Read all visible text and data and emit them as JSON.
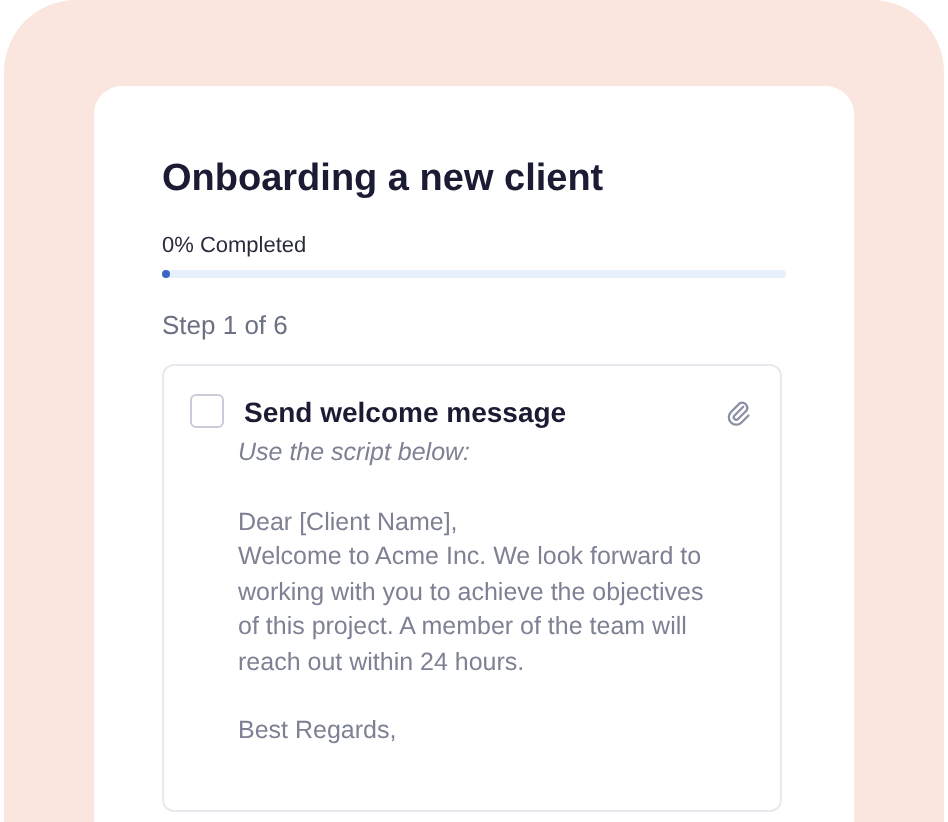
{
  "title": "Onboarding a new client",
  "progress": {
    "label": "0% Completed",
    "level": 0
  },
  "step": "Step 1 of 6",
  "task": {
    "title": "Send welcome message",
    "checked": false,
    "instruction": "Use the script below:",
    "blocks": [
      [
        "Dear [Client Name],",
        "Welcome to Acme Inc. We look forward to working with you to achieve the objectives of this project. A member of the team will reach out within 24 hours."
      ],
      [
        "Best Regards,"
      ]
    ]
  }
}
